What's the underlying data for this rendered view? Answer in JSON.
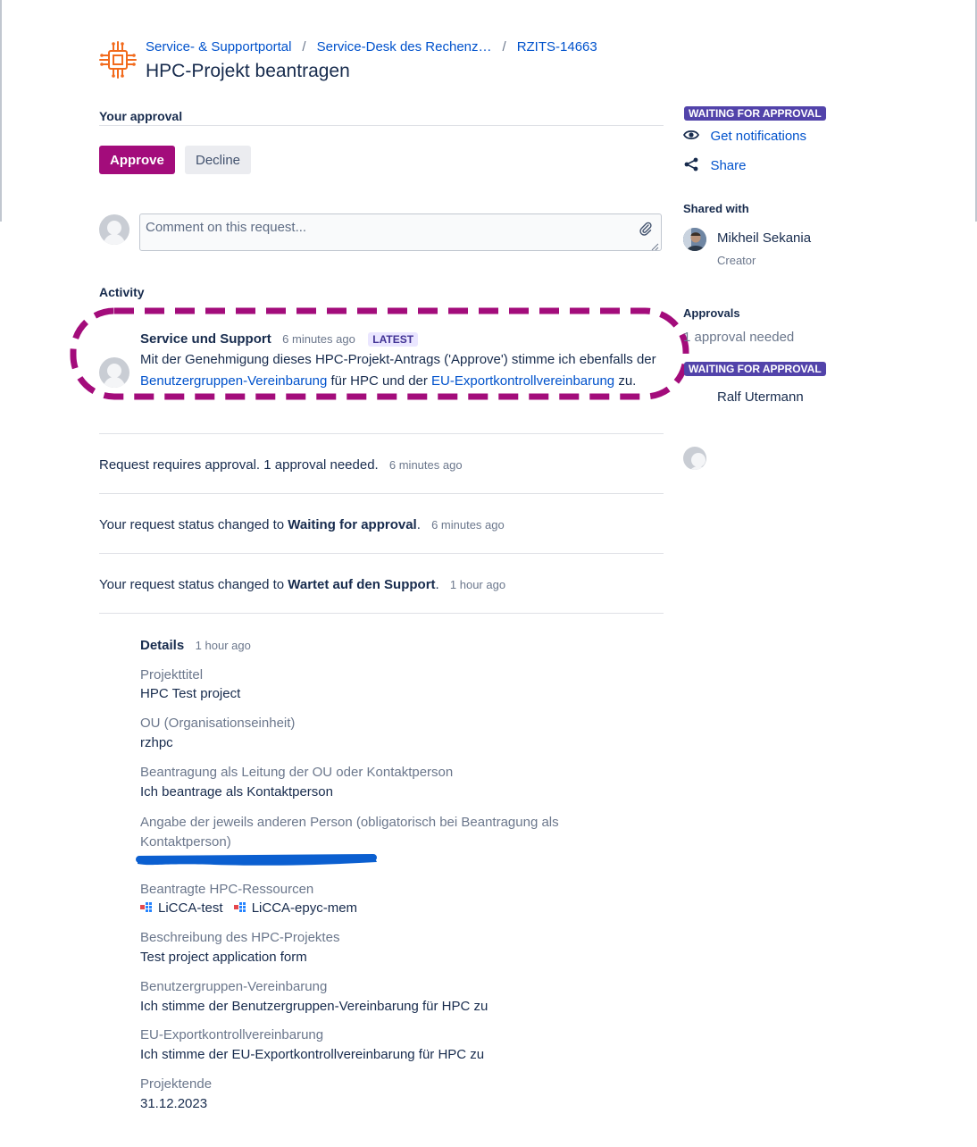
{
  "breadcrumb": {
    "items": [
      "Service- & Supportportal",
      "Service-Desk des Rechenz…",
      "RZITS-14663"
    ],
    "separator": "/"
  },
  "page_title": "HPC-Projekt beantragen",
  "approval": {
    "heading": "Your approval",
    "approve_label": "Approve",
    "decline_label": "Decline"
  },
  "comment": {
    "placeholder": "Comment on this request..."
  },
  "activity": {
    "heading": "Activity",
    "latest": {
      "author": "Service und Support",
      "time": "6 minutes ago",
      "badge": "LATEST",
      "text_before": "Mit der Genehmigung dieses HPC-Projekt-Antrags ('Approve') stimme ich ebenfalls der ",
      "link1": "Benutzergruppen-Vereinbarung",
      "text_middle": " für HPC und der ",
      "link2": "EU-Exportkontrollvereinbarung",
      "text_after": " zu."
    },
    "events": [
      {
        "text": "Request requires approval. 1 approval needed.",
        "bold": "",
        "suffix": "",
        "time": "6 minutes ago"
      },
      {
        "text": "Your request status changed to ",
        "bold": "Waiting for approval",
        "suffix": ".",
        "time": "6 minutes ago"
      },
      {
        "text": "Your request status changed to ",
        "bold": "Wartet auf den Support",
        "suffix": ".",
        "time": "1 hour ago"
      }
    ]
  },
  "details": {
    "heading": "Details",
    "time": "1 hour ago",
    "fields": [
      {
        "label": "Projekttitel",
        "value": "HPC Test project"
      },
      {
        "label": "OU (Organisationseinheit)",
        "value": "rzhpc"
      },
      {
        "label": "Beantragung als Leitung der OU oder Kontaktperson",
        "value": "Ich beantrage als Kontaktperson"
      },
      {
        "label": "Angabe der jeweils anderen Person (obligatorisch bei Beantragung als Kontaktperson)",
        "value": ""
      },
      {
        "label": "Beantragte HPC-Ressourcen",
        "value": ""
      },
      {
        "label": "Beschreibung des HPC-Projektes",
        "value": "Test project application form"
      },
      {
        "label": "Benutzergruppen-Vereinbarung",
        "value": "Ich stimme der Benutzergruppen-Vereinbarung für HPC zu"
      },
      {
        "label": "EU-Exportkontrollvereinbarung",
        "value": "Ich stimme der EU-Exportkontrollvereinbarung für HPC zu"
      },
      {
        "label": "Projektende",
        "value": "31.12.2023"
      }
    ],
    "resources": [
      "LiCCA-test",
      "LiCCA-epyc-mem"
    ]
  },
  "sidebar": {
    "status_badge": "WAITING FOR APPROVAL",
    "get_notifications": "Get notifications",
    "share": "Share",
    "shared_with_heading": "Shared with",
    "shared_person": {
      "name": "Mikheil Sekania",
      "role": "Creator"
    },
    "approvals_heading": "Approvals",
    "approvals_needed": "1 approval needed",
    "approval_badge": "WAITING FOR APPROVAL",
    "approver": "Ralf Utermann"
  },
  "colors": {
    "brand": "#a30c7b",
    "link": "#0052cc",
    "badge_purple": "#5243aa",
    "annotation": "#a30c7b",
    "redaction": "#0b5fd0",
    "logo": "#f26b1d"
  },
  "icons": {
    "logo": "chip-logo-icon",
    "attach": "paperclip-icon",
    "notify": "eye-icon",
    "share": "share-icon",
    "resource": "resource-cube-icon"
  }
}
